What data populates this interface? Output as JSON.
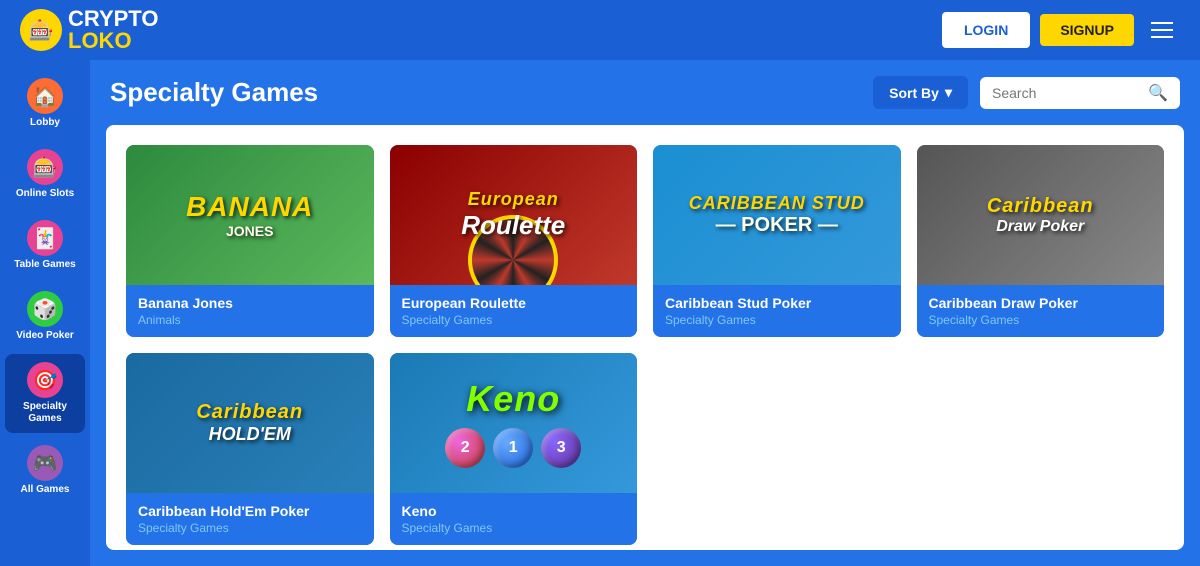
{
  "header": {
    "logo_crypto": "CRYPTO",
    "logo_loko": "LOKO",
    "login_label": "LOGIN",
    "signup_label": "SIGNUP"
  },
  "sidebar": {
    "items": [
      {
        "id": "lobby",
        "label": "Lobby",
        "icon": "🏠"
      },
      {
        "id": "online-slots",
        "label": "Online Slots",
        "icon": "🎰"
      },
      {
        "id": "table-games",
        "label": "Table Games",
        "icon": "🃏"
      },
      {
        "id": "video-poker",
        "label": "Video Poker",
        "icon": "🎲"
      },
      {
        "id": "specialty-games",
        "label": "Specialty Games",
        "icon": "🎯"
      },
      {
        "id": "all-games",
        "label": "All Games",
        "icon": "🎮"
      }
    ]
  },
  "content": {
    "page_title": "Specialty Games",
    "sort_label": "Sort By",
    "search_placeholder": "Search",
    "games": [
      {
        "id": "banana-jones",
        "name": "Banana Jones",
        "category": "Animals",
        "art_title": "BANANA\nJONES",
        "thumb_class": "thumb-banana"
      },
      {
        "id": "european-roulette",
        "name": "European Roulette",
        "category": "Specialty Games",
        "art_title": "European\nRoulette",
        "thumb_class": "thumb-roulette"
      },
      {
        "id": "caribbean-stud-poker",
        "name": "Caribbean Stud Poker",
        "category": "Specialty Games",
        "art_title": "CARIBBEAN STUD\nPOKER",
        "thumb_class": "thumb-caribbean-stud"
      },
      {
        "id": "caribbean-draw-poker",
        "name": "Caribbean Draw Poker",
        "category": "Specialty Games",
        "art_title": "Caribbean\nDraw Poker",
        "thumb_class": "thumb-caribbean-draw"
      },
      {
        "id": "caribbean-holdem",
        "name": "Caribbean Hold'Em Poker",
        "category": "Specialty Games",
        "art_title": "Caribbean\nHOLD'EM",
        "thumb_class": "thumb-holdem"
      },
      {
        "id": "keno",
        "name": "Keno",
        "category": "Specialty Games",
        "art_title": "Keno",
        "thumb_class": "thumb-keno"
      }
    ]
  }
}
